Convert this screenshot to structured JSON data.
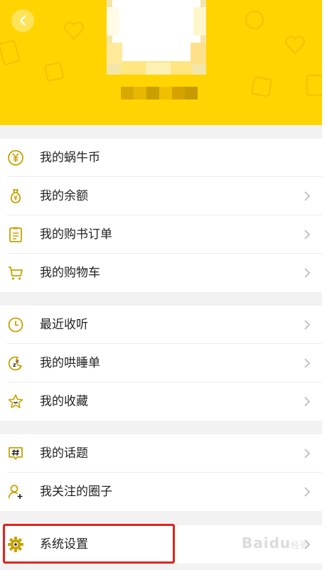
{
  "header": {
    "background_color": "#ffd400",
    "back_icon": "chevron-left-icon",
    "avatar": "pixelated-avatar",
    "nickname": "pixelated-nickname"
  },
  "groups": [
    {
      "items": [
        {
          "label": "我的蜗牛币",
          "icon": "yuan-coin-icon",
          "chevron": false
        },
        {
          "label": "我的余额",
          "icon": "money-bag-icon",
          "chevron": true
        },
        {
          "label": "我的购书订单",
          "icon": "order-list-icon",
          "chevron": true
        },
        {
          "label": "我的购物车",
          "icon": "cart-icon",
          "chevron": true
        }
      ]
    },
    {
      "items": [
        {
          "label": "最近收听",
          "icon": "clock-icon",
          "chevron": true
        },
        {
          "label": "我的哄睡单",
          "icon": "sleep-moon-icon",
          "chevron": true
        },
        {
          "label": "我的收藏",
          "icon": "star-icon",
          "chevron": true
        }
      ]
    },
    {
      "items": [
        {
          "label": "我的话题",
          "icon": "hashtag-icon",
          "chevron": true
        },
        {
          "label": "我关注的圈子",
          "icon": "follow-user-icon",
          "chevron": true
        }
      ]
    },
    {
      "items": [
        {
          "label": "系统设置",
          "icon": "gear-icon",
          "chevron": true
        }
      ]
    }
  ],
  "accent_color": "#c9a200",
  "highlight_color": "#e2231a",
  "watermark": {
    "text": "Baidu",
    "sub": "经验"
  }
}
